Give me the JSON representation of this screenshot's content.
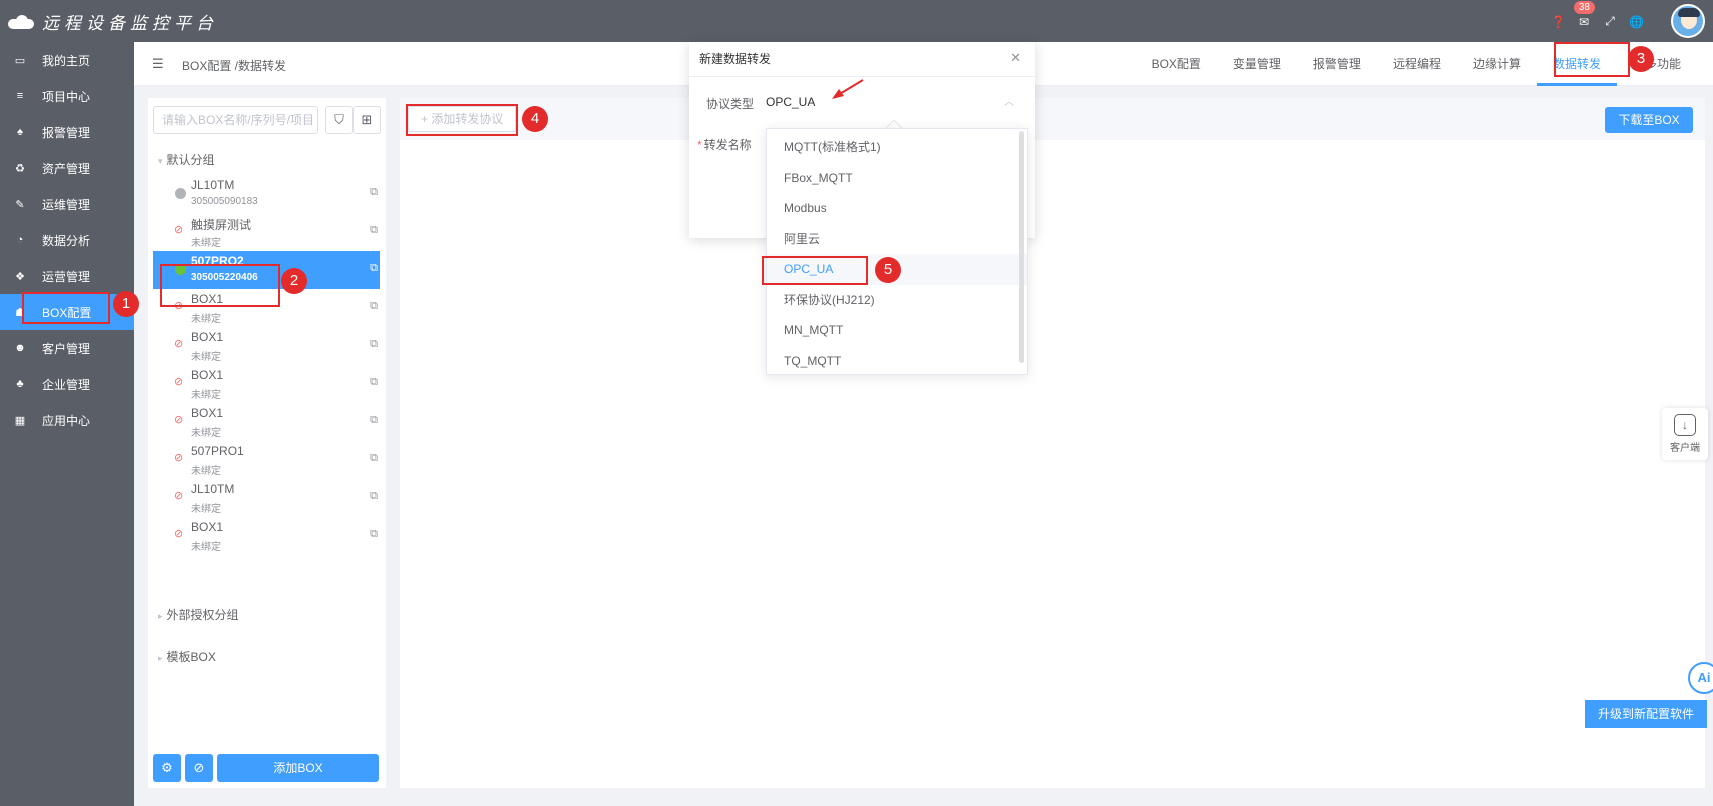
{
  "app": {
    "title": "远程设备监控平台"
  },
  "topbar": {
    "badge_count": "38"
  },
  "sidebar": {
    "items": [
      {
        "label": "我的主页",
        "icon": "monitor-icon",
        "glyph": "▭"
      },
      {
        "label": "项目中心",
        "icon": "list-icon",
        "glyph": "≡"
      },
      {
        "label": "报警管理",
        "icon": "bell-icon",
        "glyph": "♠"
      },
      {
        "label": "资产管理",
        "icon": "recycle-icon",
        "glyph": "♻"
      },
      {
        "label": "运维管理",
        "icon": "wrench-icon",
        "glyph": "✎"
      },
      {
        "label": "数据分析",
        "icon": "chart-icon",
        "glyph": "◔"
      },
      {
        "label": "运营管理",
        "icon": "cubes-icon",
        "glyph": "❖"
      },
      {
        "label": "BOX配置",
        "icon": "box-config-icon",
        "glyph": "☗"
      },
      {
        "label": "客户管理",
        "icon": "users-icon",
        "glyph": "☻"
      },
      {
        "label": "企业管理",
        "icon": "org-icon",
        "glyph": "♣"
      },
      {
        "label": "应用中心",
        "icon": "grid-icon",
        "glyph": "▦"
      }
    ]
  },
  "header": {
    "breadcrumb": "BOX配置 /数据转发",
    "tabs": [
      "BOX配置",
      "变量管理",
      "报警管理",
      "远程编程",
      "边缘计算",
      "数据转发",
      "更多功能"
    ]
  },
  "leftpanel": {
    "search_placeholder": "请输入BOX名称/序列号/项目",
    "default_group": "默认分组",
    "devices": [
      {
        "name": "JL10TM",
        "sub": "305005090183",
        "status": "offline"
      },
      {
        "name": "触摸屏测试",
        "sub": "未绑定",
        "status": "unbound"
      },
      {
        "name": "507PRO2",
        "sub": "305005220406",
        "status": "online"
      },
      {
        "name": "BOX1",
        "sub": "未绑定",
        "status": "unbound"
      },
      {
        "name": "BOX1",
        "sub": "未绑定",
        "status": "unbound"
      },
      {
        "name": "BOX1",
        "sub": "未绑定",
        "status": "unbound"
      },
      {
        "name": "BOX1",
        "sub": "未绑定",
        "status": "unbound"
      },
      {
        "name": "507PRO1",
        "sub": "未绑定",
        "status": "unbound"
      },
      {
        "name": "JL10TM",
        "sub": "未绑定",
        "status": "unbound"
      },
      {
        "name": "BOX1",
        "sub": "未绑定",
        "status": "unbound"
      }
    ],
    "external_group": "外部授权分组",
    "template_group": "模板BOX",
    "add_box": "添加BOX"
  },
  "main": {
    "add_protocol": "+ 添加转发协议",
    "download": "下载至BOX",
    "upgrade": "升级到新配置软件",
    "help_label": "客户端",
    "ai_label": "Ai"
  },
  "dialog": {
    "title": "新建数据转发",
    "protocol_label": "协议类型",
    "protocol_value": "OPC_UA",
    "name_label": "转发名称",
    "options": [
      "MQTT(标准格式1)",
      "FBox_MQTT",
      "Modbus",
      "阿里云",
      "OPC_UA",
      "环保协议(HJ212)",
      "MN_MQTT",
      "TQ_MQTT"
    ],
    "selected": "OPC_UA"
  },
  "annotations": [
    "1",
    "2",
    "3",
    "4",
    "5"
  ],
  "colors": {
    "primary": "#409eff",
    "sidebar": "#5a5e66",
    "annotation": "#e32b2b",
    "online": "#67c23a"
  }
}
